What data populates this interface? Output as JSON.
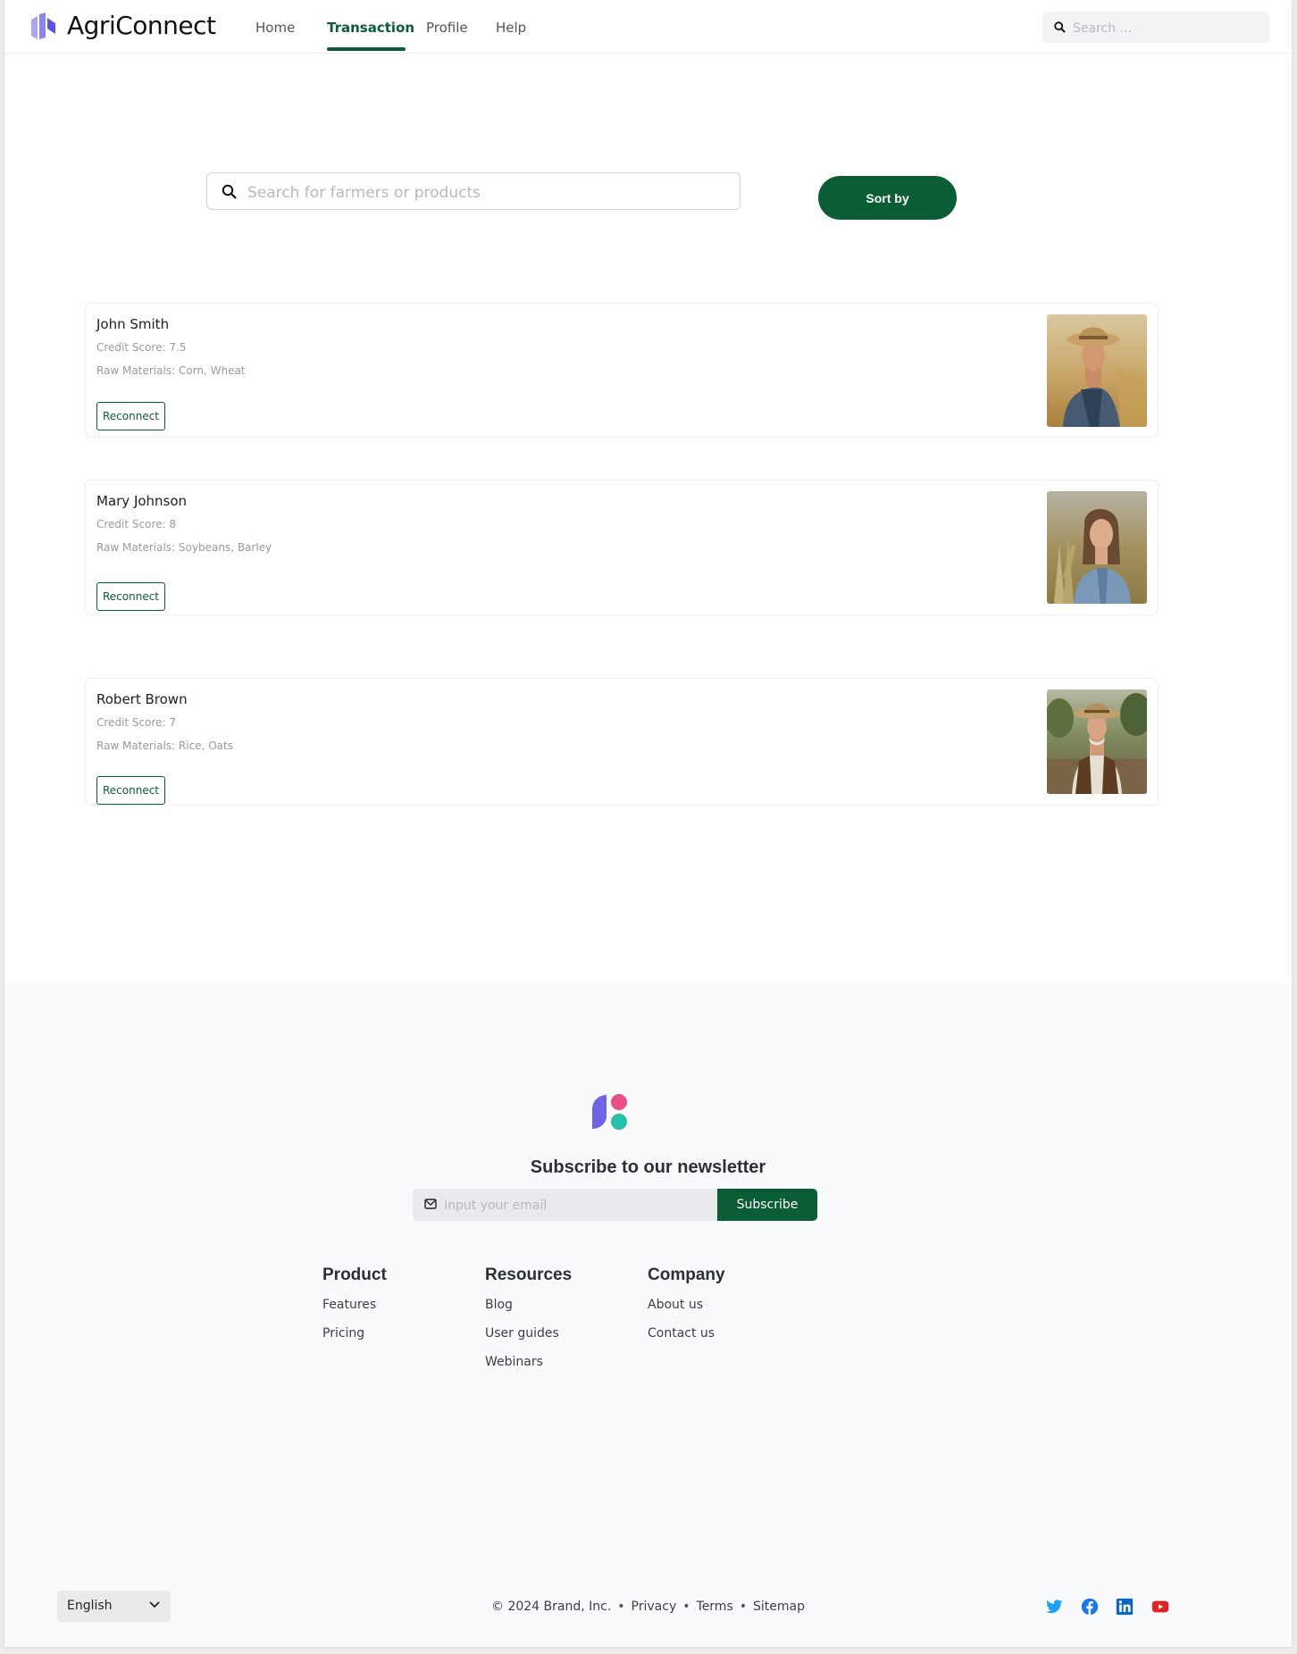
{
  "header": {
    "brand": "AgriConnect",
    "nav": [
      "Home",
      "Transaction",
      "Profile",
      "Help"
    ],
    "active_nav": "Transaction",
    "search_placeholder": "Search ..."
  },
  "main": {
    "search_placeholder": "Search for farmers or products",
    "sort_label": "Sort by",
    "farmers": [
      {
        "name": "John Smith",
        "credit": "Credit Score: 7.5",
        "raw": "Raw Materials: Corn, Wheat",
        "button": "Reconnect",
        "photo_icon": "farmer-photo-hat"
      },
      {
        "name": "Mary Johnson",
        "credit": "Credit Score: 8",
        "raw": "Raw Materials: Soybeans, Barley",
        "button": "Reconnect",
        "photo_icon": "farmer-photo-woman"
      },
      {
        "name": "Robert Brown",
        "credit": "Credit Score: 7",
        "raw": "Raw Materials: Rice, Oats",
        "button": "Reconnect",
        "photo_icon": "farmer-photo-elder"
      }
    ]
  },
  "footer": {
    "newsletter_title": "Subscribe to our newsletter",
    "email_placeholder": "Input your email",
    "subscribe_label": "Subscribe",
    "columns": [
      {
        "title": "Product",
        "links": [
          "Features",
          "Pricing"
        ]
      },
      {
        "title": "Resources",
        "links": [
          "Blog",
          "User guides",
          "Webinars"
        ]
      },
      {
        "title": "Company",
        "links": [
          "About us",
          "Contact us"
        ]
      }
    ],
    "language": "English",
    "copyright": "© 2024 Brand, Inc.",
    "legal_links": [
      "Privacy",
      "Terms",
      "Sitemap"
    ],
    "social": [
      "twitter-icon",
      "facebook-icon",
      "linkedin-icon",
      "youtube-icon"
    ]
  },
  "colors": {
    "accent": "#0b5d35",
    "footer_bg": "#f9fafb",
    "twitter": "#1da1f2",
    "facebook": "#1877f2",
    "linkedin": "#0a66c2",
    "youtube": "#e02424"
  }
}
